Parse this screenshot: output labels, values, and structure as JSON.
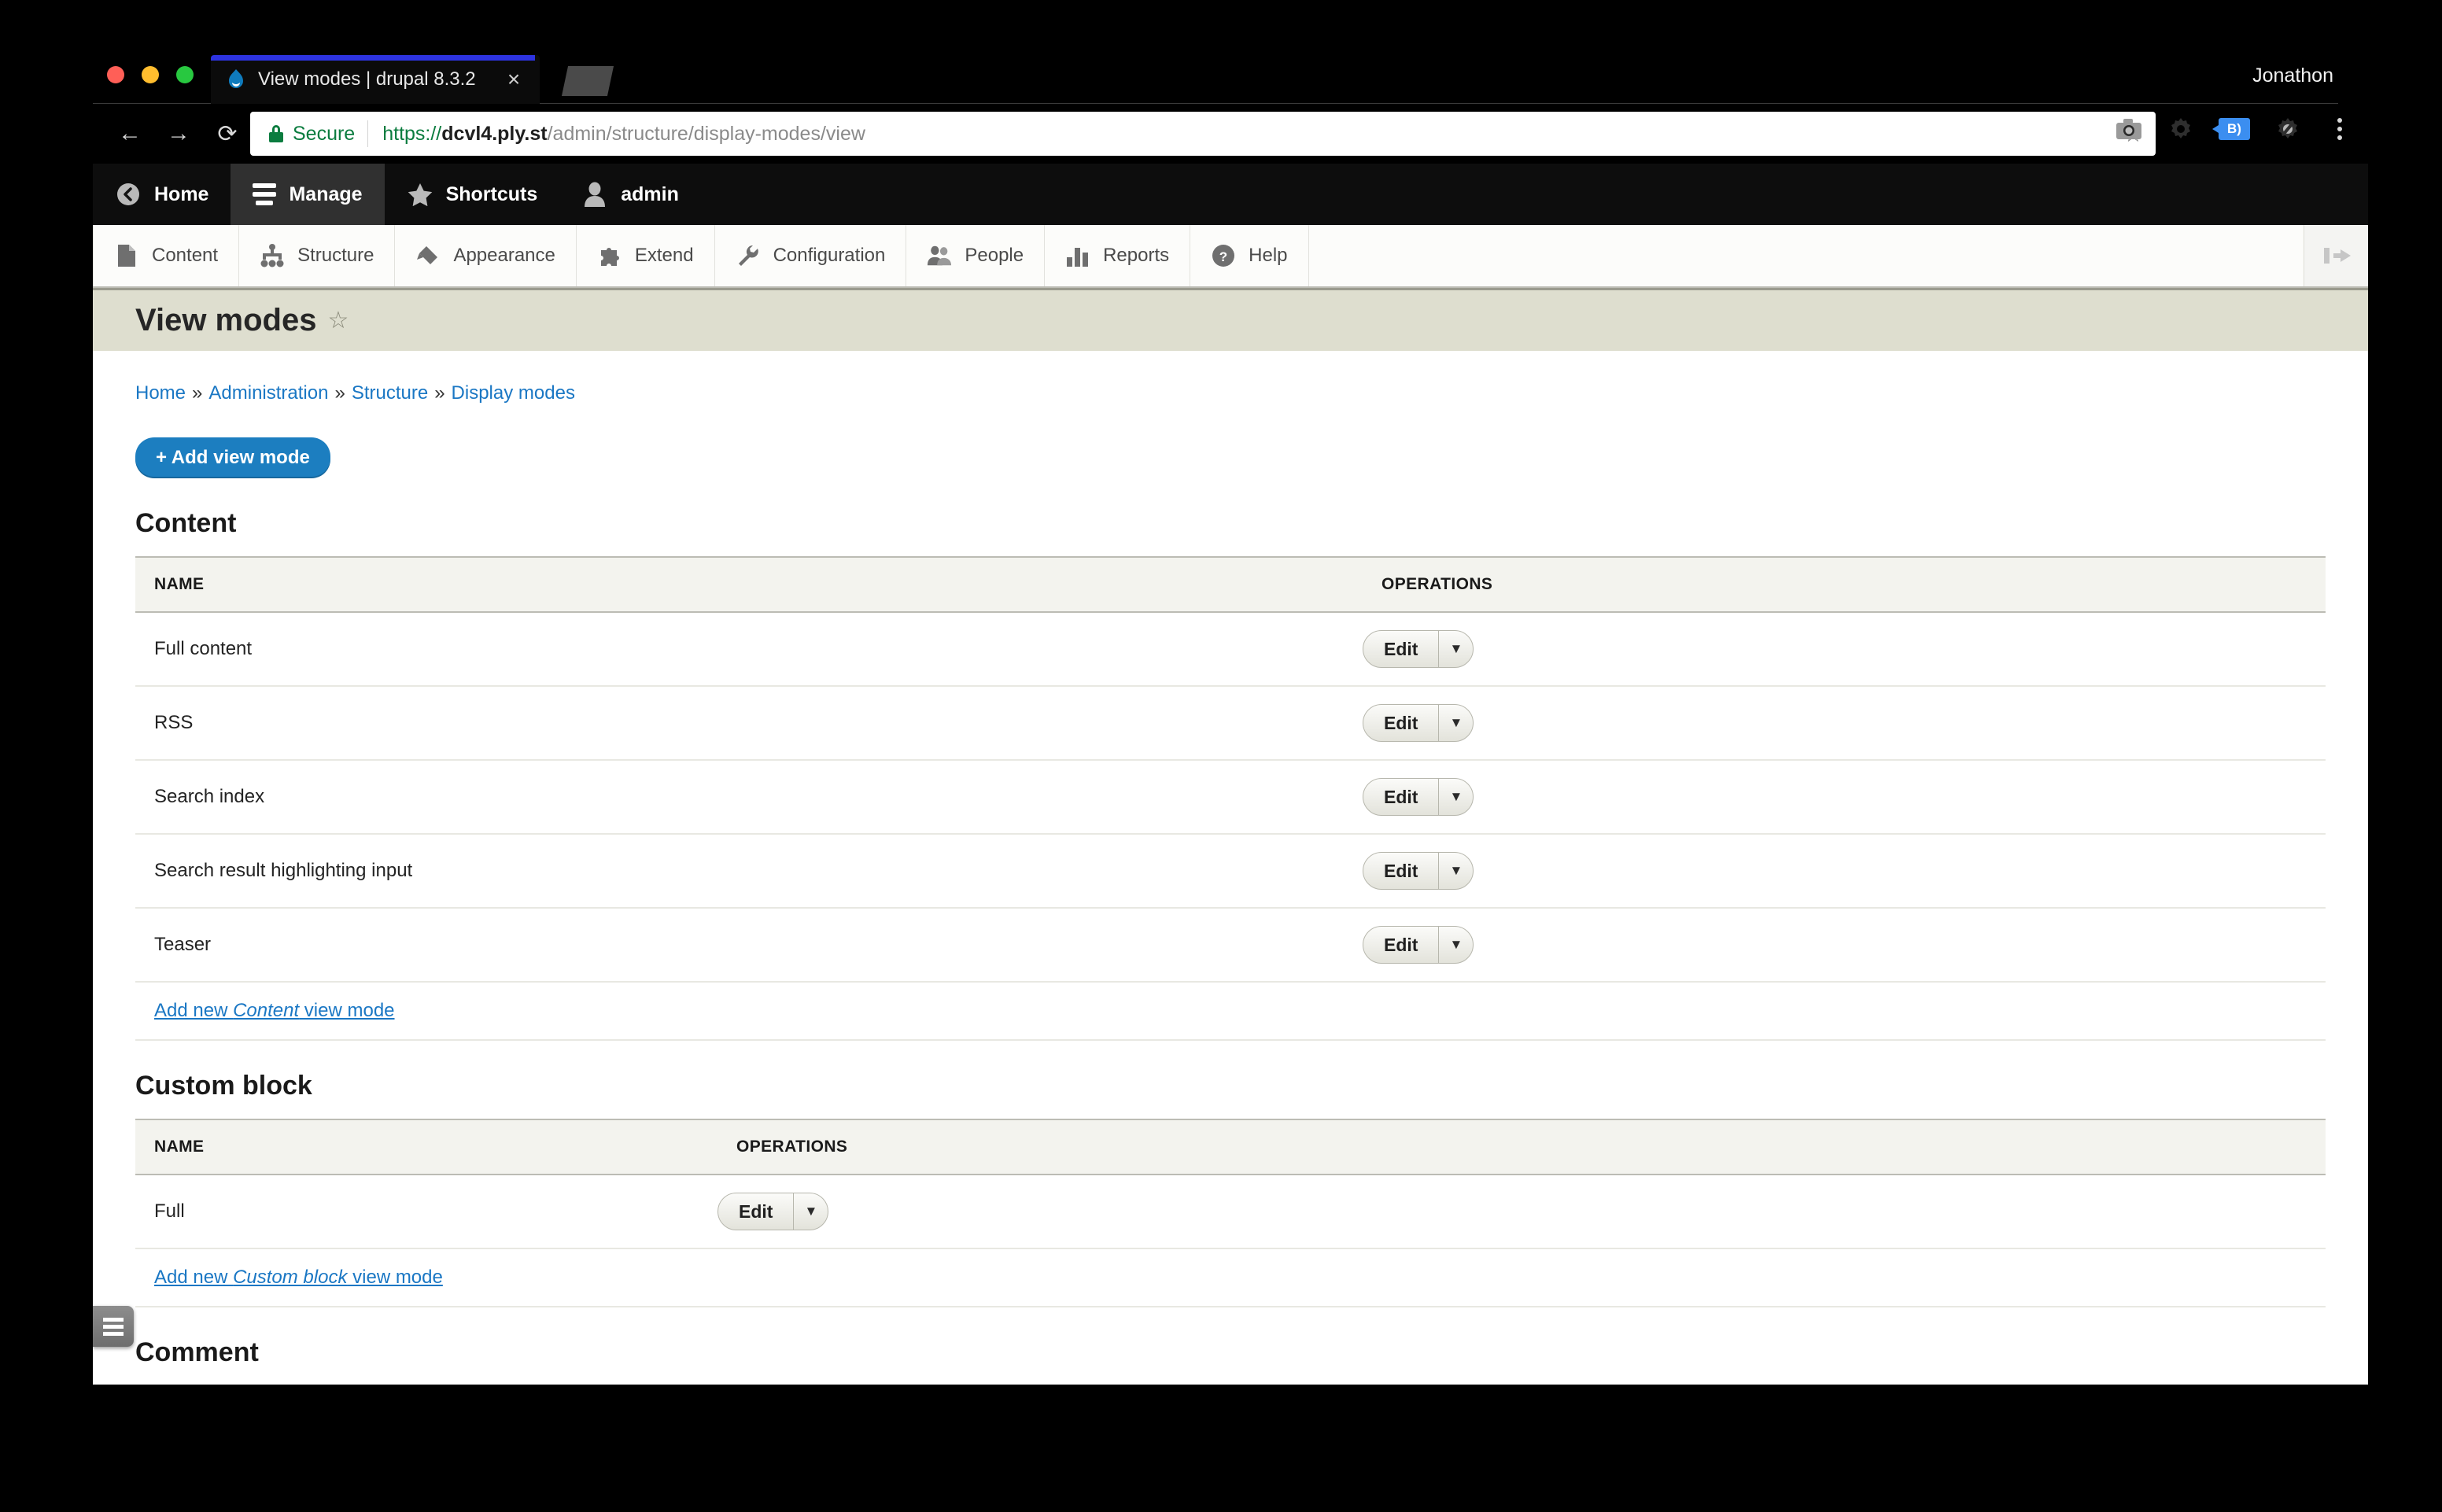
{
  "browser": {
    "profile_name": "Jonathon",
    "tab": {
      "title": "View modes | drupal 8.3.2",
      "close_label": "×",
      "favicon": "drupal-drop-icon"
    },
    "nav": {
      "back": "←",
      "forward": "→",
      "reload": "⟳"
    },
    "omnibox": {
      "security_label": "Secure",
      "url_scheme": "https://",
      "url_host": "dcvl4.ply.st",
      "url_path": "/admin/structure/display-modes/view",
      "star": "☆"
    },
    "toolbar_icons": [
      "camera-icon",
      "gear-icon",
      "tag-badge-icon",
      "bug-gear-icon",
      "kebab-menu-icon"
    ],
    "badge_text": "B)"
  },
  "drupal_toolbar": {
    "items": [
      {
        "label": "Home",
        "icon": "back-circle-icon",
        "active": false
      },
      {
        "label": "Manage",
        "icon": "hamburger-icon",
        "active": true
      },
      {
        "label": "Shortcuts",
        "icon": "star-icon",
        "active": false
      },
      {
        "label": "admin",
        "icon": "user-icon",
        "active": false
      }
    ]
  },
  "admin_menu": {
    "items": [
      {
        "label": "Content",
        "icon": "document-icon"
      },
      {
        "label": "Structure",
        "icon": "sitemap-icon"
      },
      {
        "label": "Appearance",
        "icon": "brush-icon"
      },
      {
        "label": "Extend",
        "icon": "puzzle-icon"
      },
      {
        "label": "Configuration",
        "icon": "wrench-icon"
      },
      {
        "label": "People",
        "icon": "people-icon"
      },
      {
        "label": "Reports",
        "icon": "bars-icon"
      },
      {
        "label": "Help",
        "icon": "question-icon"
      }
    ],
    "collapse_icon": "collapse-left-icon"
  },
  "page": {
    "title": "View modes",
    "title_star": "☆",
    "breadcrumb": [
      {
        "label": "Home"
      },
      {
        "label": "Administration"
      },
      {
        "label": "Structure"
      },
      {
        "label": "Display modes"
      }
    ],
    "breadcrumb_separator": "»",
    "add_button": "+ Add view mode",
    "columns": {
      "name": "NAME",
      "operations": "OPERATIONS"
    },
    "edit_label": "Edit",
    "dropdown_arrow": "▼",
    "sections": [
      {
        "heading": "Content",
        "ops_offset": "wide",
        "rows": [
          {
            "name": "Full content"
          },
          {
            "name": "RSS"
          },
          {
            "name": "Search index"
          },
          {
            "name": "Search result highlighting input"
          },
          {
            "name": "Teaser"
          }
        ],
        "add_new_prefix": "Add new ",
        "add_new_em": "Content",
        "add_new_suffix": " view mode"
      },
      {
        "heading": "Custom block",
        "ops_offset": "narrow",
        "rows": [
          {
            "name": "Full"
          }
        ],
        "add_new_prefix": "Add new ",
        "add_new_em": "Custom block",
        "add_new_suffix": " view mode"
      },
      {
        "heading": "Comment",
        "ops_offset": "narrow",
        "rows": [],
        "add_new_prefix": "",
        "add_new_em": "",
        "add_new_suffix": ""
      }
    ]
  },
  "tray_tab": {
    "icon": "hamburger-tray-icon"
  },
  "colors": {
    "accent_blue": "#1c7ec0",
    "link_blue": "#1a77c4",
    "header_band": "#dedecf",
    "table_head": "#f3f3ee",
    "tab_accent": "#2d33e0",
    "secure_green": "#0b7c3f"
  }
}
